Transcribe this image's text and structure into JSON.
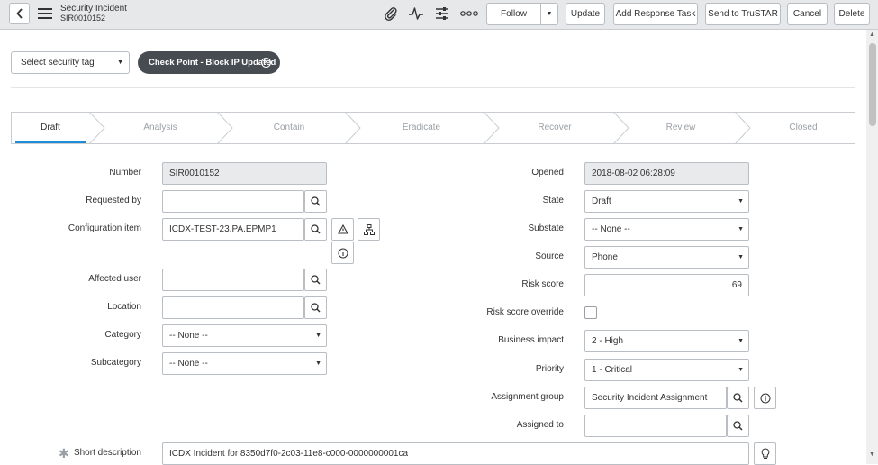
{
  "header": {
    "title": "Security Incident",
    "number": "SIR0010152",
    "icons": [
      "paperclip-icon",
      "activity-icon",
      "settings-sliders-icon",
      "more-icon"
    ],
    "buttons": {
      "follow": "Follow",
      "update": "Update",
      "add_response_task": "Add Response Task",
      "send_to_trustar": "Send to TruSTAR",
      "cancel": "Cancel",
      "delete": "Delete"
    }
  },
  "tags": {
    "select_placeholder": "Select security tag",
    "applied": [
      "Check Point - Block IP Updated"
    ]
  },
  "process_flow": {
    "stages": [
      "Draft",
      "Analysis",
      "Contain",
      "Eradicate",
      "Recover",
      "Review",
      "Closed"
    ],
    "active": "Draft"
  },
  "form": {
    "left": {
      "number": {
        "label": "Number",
        "value": "SIR0010152"
      },
      "requested_by": {
        "label": "Requested by",
        "value": ""
      },
      "configuration_item": {
        "label": "Configuration item",
        "value": "ICDX-TEST-23.PA.EPMP1"
      },
      "affected_user": {
        "label": "Affected user",
        "value": ""
      },
      "location": {
        "label": "Location",
        "value": ""
      },
      "category": {
        "label": "Category",
        "value": "-- None --"
      },
      "subcategory": {
        "label": "Subcategory",
        "value": "-- None --"
      }
    },
    "right": {
      "opened": {
        "label": "Opened",
        "value": "2018-08-02 06:28:09"
      },
      "state": {
        "label": "State",
        "value": "Draft"
      },
      "substate": {
        "label": "Substate",
        "value": "-- None --"
      },
      "source": {
        "label": "Source",
        "value": "Phone"
      },
      "risk_score": {
        "label": "Risk score",
        "value": "69"
      },
      "risk_score_override": {
        "label": "Risk score override",
        "checked": false
      },
      "business_impact": {
        "label": "Business impact",
        "value": "2 - High"
      },
      "priority": {
        "label": "Priority",
        "value": "1 - Critical"
      },
      "assignment_group": {
        "label": "Assignment group",
        "value": "Security Incident Assignment"
      },
      "assigned_to": {
        "label": "Assigned to",
        "value": ""
      }
    },
    "short_description": {
      "label": "Short description",
      "value": "ICDX Incident for 8350d7f0-2c03-11e8-c000-0000000001ca"
    }
  }
}
